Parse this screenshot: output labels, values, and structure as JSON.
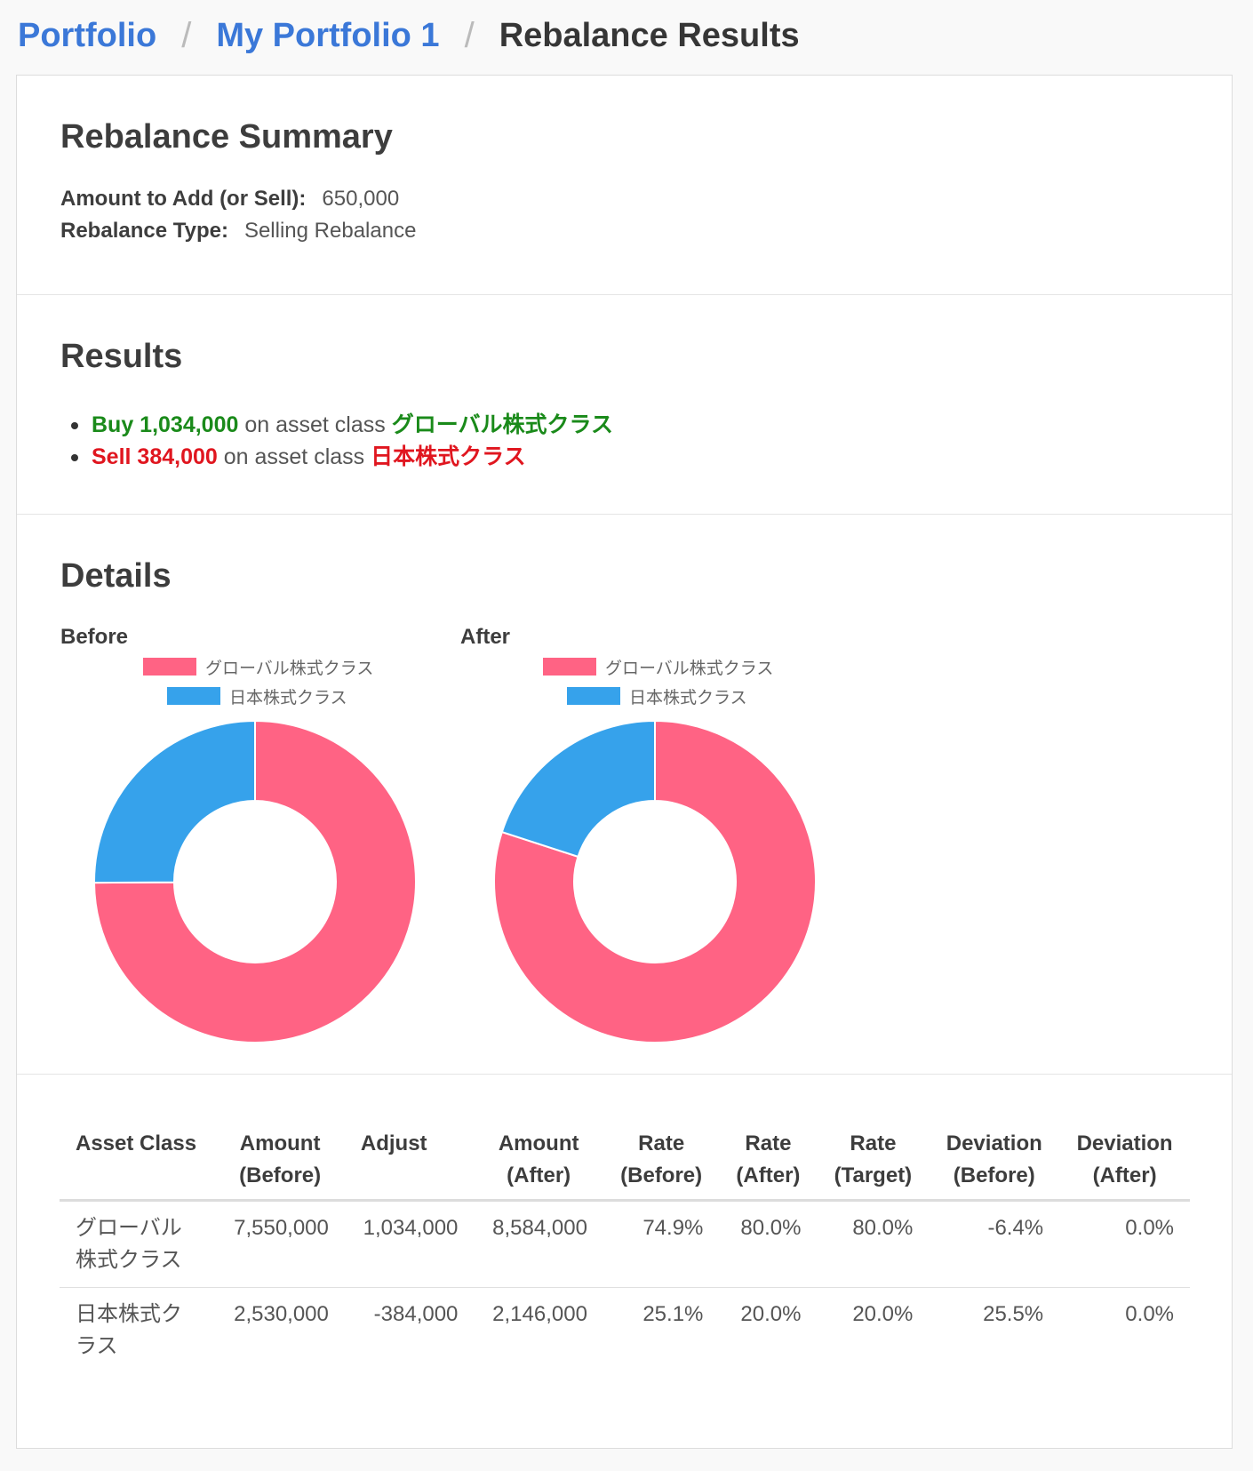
{
  "breadcrumb": {
    "root": "Portfolio",
    "portfolio": "My Portfolio 1",
    "current": "Rebalance Results",
    "separator": "/"
  },
  "summary": {
    "title": "Rebalance Summary",
    "amount_label": "Amount to Add (or Sell):",
    "amount_value": "650,000",
    "type_label": "Rebalance Type:",
    "type_value": "Selling Rebalance"
  },
  "results": {
    "title": "Results",
    "items": [
      {
        "action": "Buy 1,034,000",
        "middle": "on asset class",
        "asset": "グローバル株式クラス",
        "kind": "buy"
      },
      {
        "action": "Sell 384,000",
        "middle": "on asset class",
        "asset": "日本株式クラス",
        "kind": "sell"
      }
    ]
  },
  "details": {
    "title": "Details",
    "colors": {
      "global": "#ff6384",
      "japan": "#36a2eb"
    }
  },
  "chart_data": [
    {
      "type": "pie",
      "title": "Before",
      "categories": [
        "グローバル株式クラス",
        "日本株式クラス"
      ],
      "values": [
        74.9,
        25.1
      ],
      "legend": "top"
    },
    {
      "type": "pie",
      "title": "After",
      "categories": [
        "グローバル株式クラス",
        "日本株式クラス"
      ],
      "values": [
        80.0,
        20.0
      ],
      "legend": "top"
    }
  ],
  "table": {
    "headers": [
      [
        "Asset Class",
        ""
      ],
      [
        "Amount",
        "(Before)"
      ],
      [
        "Adjust",
        ""
      ],
      [
        "Amount",
        "(After)"
      ],
      [
        "Rate",
        "(Before)"
      ],
      [
        "Rate",
        "(After)"
      ],
      [
        "Rate",
        "(Target)"
      ],
      [
        "Deviation",
        "(Before)"
      ],
      [
        "Deviation",
        "(After)"
      ]
    ],
    "rows": [
      {
        "asset_line1": "グローバル",
        "asset_line2": "株式クラス",
        "cells": [
          "7,550,000",
          "1,034,000",
          "8,584,000",
          "74.9%",
          "80.0%",
          "80.0%",
          "-6.4%",
          "0.0%"
        ]
      },
      {
        "asset_line1": "日本株式ク",
        "asset_line2": "ラス",
        "cells": [
          "2,530,000",
          "-384,000",
          "2,146,000",
          "25.1%",
          "20.0%",
          "20.0%",
          "25.5%",
          "0.0%"
        ]
      }
    ]
  }
}
